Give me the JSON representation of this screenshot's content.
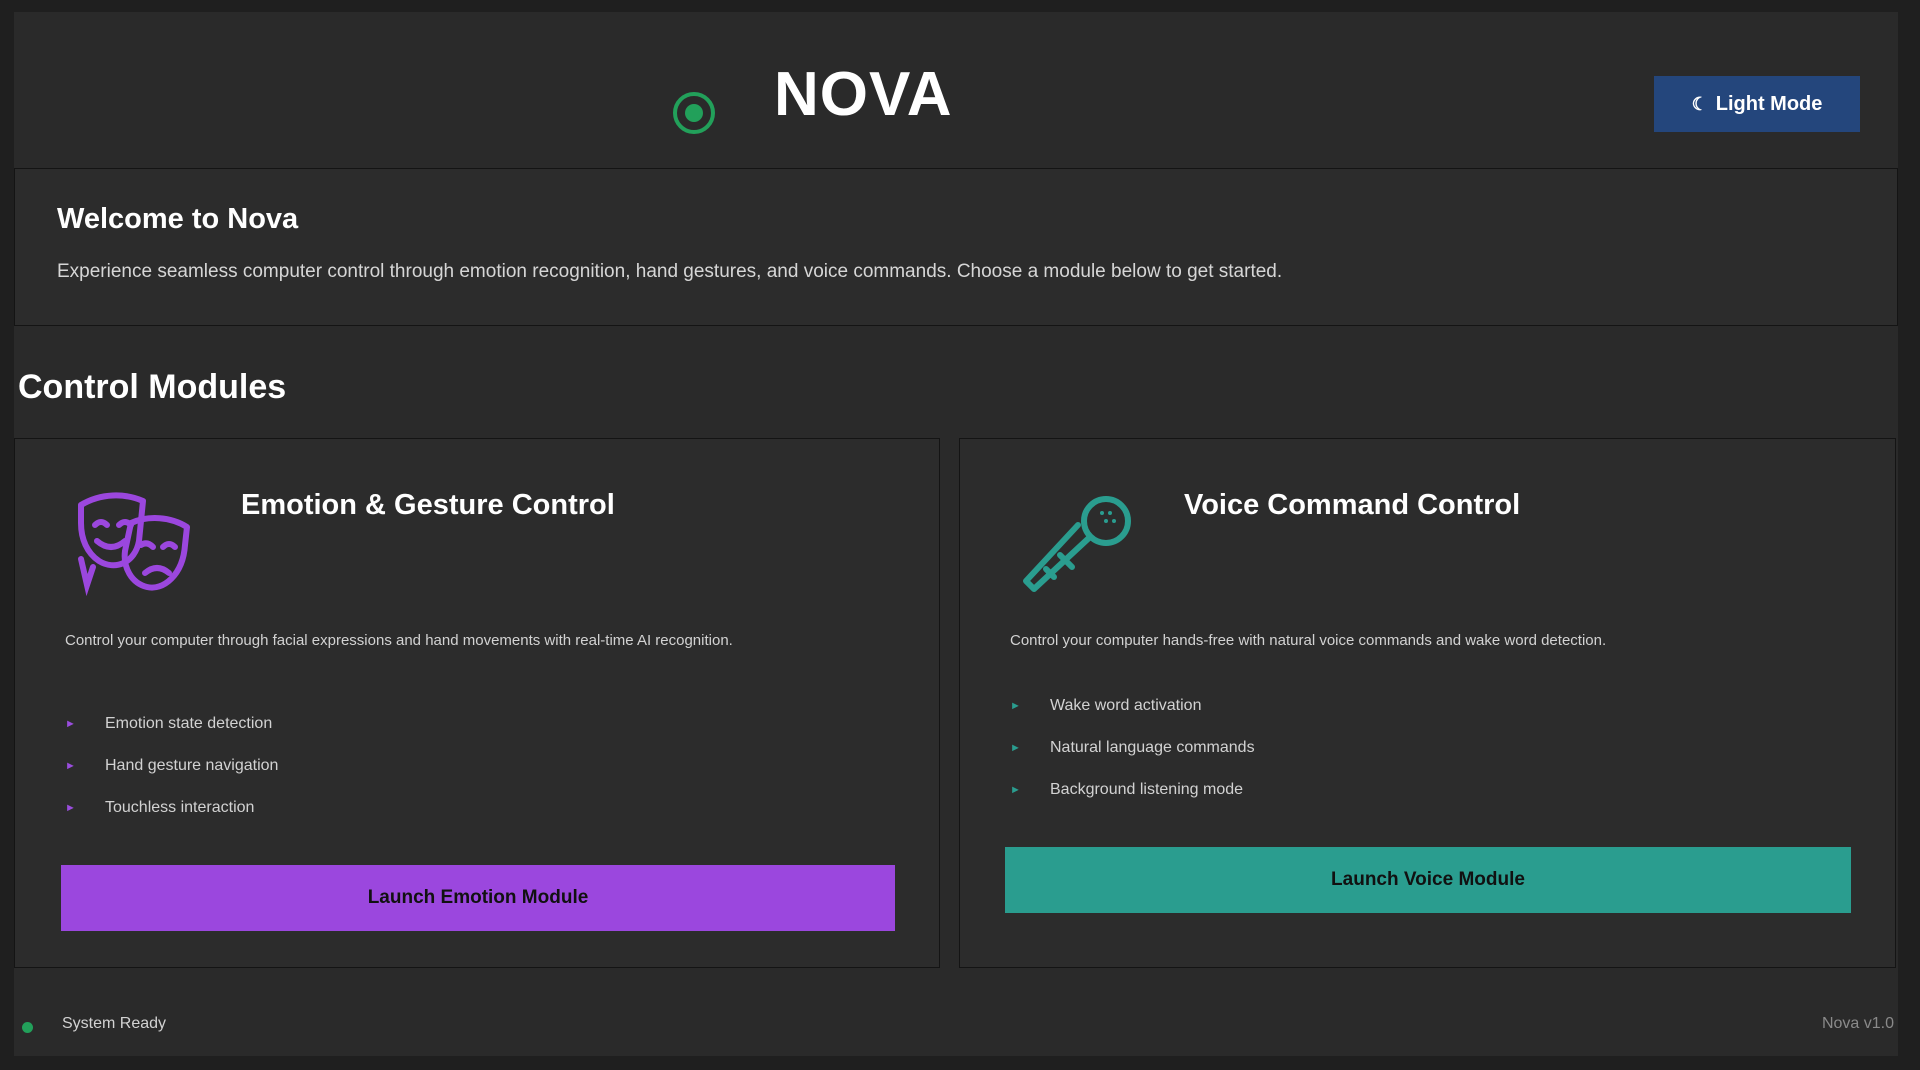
{
  "header": {
    "title": "NOVA",
    "theme_button_label": "Light Mode",
    "theme_button_icon": "moon-icon"
  },
  "welcome": {
    "title": "Welcome to Nova",
    "description": "Experience seamless computer control through emotion recognition, hand gestures, and voice commands. Choose a module below to get started."
  },
  "modules_section": {
    "title": "Control Modules"
  },
  "modules": [
    {
      "title": "Emotion & Gesture Control",
      "icon": "theater-masks-icon",
      "description": "Control your computer through facial expressions and hand movements with real-time AI recognition.",
      "features": [
        "Emotion state detection",
        "Hand gesture navigation",
        "Touchless interaction"
      ],
      "button_label": "Launch Emotion Module",
      "accent": "#9b47de"
    },
    {
      "title": "Voice Command Control",
      "icon": "microphone-icon",
      "description": "Control your computer hands-free with natural voice commands and wake word detection.",
      "features": [
        "Wake word activation",
        "Natural language commands",
        "Background listening mode"
      ],
      "button_label": "Launch Voice Module",
      "accent": "#2a9d8f"
    }
  ],
  "footer": {
    "status": "System Ready",
    "version": "Nova v1.0"
  },
  "colors": {
    "background": "#2a2a2a",
    "status_green": "#22a05a",
    "theme_button": "#24467c"
  }
}
